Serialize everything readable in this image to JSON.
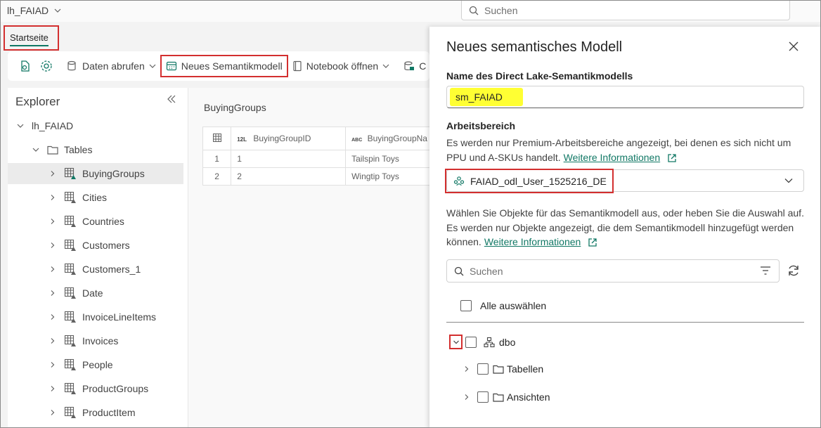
{
  "topbar": {
    "workspace_title": "lh_FAIAD",
    "search_placeholder": "Suchen"
  },
  "tabs": {
    "home": "Startseite"
  },
  "toolbar": {
    "get_data": "Daten abrufen",
    "new_semantic_model": "Neues Semantikmodell",
    "open_notebook": "Notebook öffnen",
    "truncated": "C"
  },
  "explorer": {
    "title": "Explorer",
    "root": "lh_FAIAD",
    "tables_folder": "Tables",
    "tables": [
      "BuyingGroups",
      "Cities",
      "Countries",
      "Customers",
      "Customers_1",
      "Date",
      "InvoiceLineItems",
      "Invoices",
      "People",
      "ProductGroups",
      "ProductItem"
    ],
    "selected": "BuyingGroups"
  },
  "preview": {
    "title": "BuyingGroups",
    "columns": [
      {
        "type": "12L",
        "name": "BuyingGroupID"
      },
      {
        "type": "ABC",
        "name": "BuyingGroupNa"
      }
    ],
    "rows": [
      {
        "n": "1",
        "id": "1",
        "name": "Tailspin Toys"
      },
      {
        "n": "2",
        "id": "2",
        "name": "Wingtip Toys"
      }
    ]
  },
  "panel": {
    "title": "Neues semantisches Modell",
    "name_label": "Name des Direct Lake-Semantikmodells",
    "name_value": "sm_FAIAD",
    "workspace_label": "Arbeitsbereich",
    "workspace_info_line1": "Es werden nur Premium-Arbeitsbereiche angezeigt, bei denen es sich nicht um",
    "workspace_info_line2": "PPU und A-SKUs handelt.",
    "more_info": "Weitere Informationen",
    "workspace_value": "FAIAD_odl_User_1525216_DE",
    "objects_line1": "Wählen Sie Objekte für das Semantikmodell aus, oder heben Sie die Auswahl auf.",
    "objects_line2": "Es werden nur Objekte angezeigt, die dem Semantikmodell hinzugefügt werden",
    "objects_line3": "können.",
    "search_placeholder": "Suchen",
    "select_all": "Alle auswählen",
    "schema": "dbo",
    "tables_node": "Tabellen",
    "views_node": "Ansichten"
  }
}
